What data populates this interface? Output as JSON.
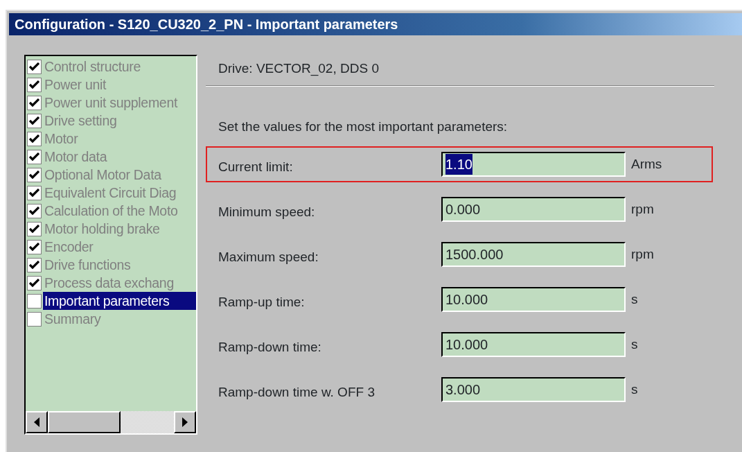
{
  "window": {
    "title": "Configuration - S120_CU320_2_PN - Important parameters"
  },
  "steps": [
    {
      "label": "Control structure",
      "checked": true,
      "selected": false
    },
    {
      "label": "Power unit",
      "checked": true,
      "selected": false
    },
    {
      "label": "Power unit supplement",
      "checked": true,
      "selected": false
    },
    {
      "label": "Drive setting",
      "checked": true,
      "selected": false
    },
    {
      "label": "Motor",
      "checked": true,
      "selected": false
    },
    {
      "label": "Motor data",
      "checked": true,
      "selected": false
    },
    {
      "label": "Optional Motor Data",
      "checked": true,
      "selected": false
    },
    {
      "label": "Equivalent Circuit Diag",
      "checked": true,
      "selected": false
    },
    {
      "label": "Calculation of the Moto",
      "checked": true,
      "selected": false
    },
    {
      "label": "Motor holding brake",
      "checked": true,
      "selected": false
    },
    {
      "label": "Encoder",
      "checked": true,
      "selected": false
    },
    {
      "label": "Drive functions",
      "checked": true,
      "selected": false
    },
    {
      "label": "Process data exchang",
      "checked": true,
      "selected": false
    },
    {
      "label": "Important parameters",
      "checked": false,
      "selected": true
    },
    {
      "label": "Summary",
      "checked": false,
      "selected": false
    }
  ],
  "drive": "Drive: VECTOR_02, DDS 0",
  "instruction": "Set the values for the most important parameters:",
  "parameters": [
    {
      "label": "Current limit:",
      "value": "1.10",
      "unit": "Arms",
      "highlighted": true,
      "value_selected": true
    },
    {
      "label": "Minimum speed:",
      "value": "0.000",
      "unit": "rpm",
      "highlighted": false,
      "value_selected": false
    },
    {
      "label": "Maximum speed:",
      "value": "1500.000",
      "unit": "rpm",
      "highlighted": false,
      "value_selected": false
    },
    {
      "label": "Ramp-up time:",
      "value": "10.000",
      "unit": "s",
      "highlighted": false,
      "value_selected": false
    },
    {
      "label": "Ramp-down time:",
      "value": "10.000",
      "unit": "s",
      "highlighted": false,
      "value_selected": false
    },
    {
      "label": "Ramp-down time w. OFF 3",
      "value": "3.000",
      "unit": "s",
      "highlighted": false,
      "value_selected": false
    }
  ]
}
